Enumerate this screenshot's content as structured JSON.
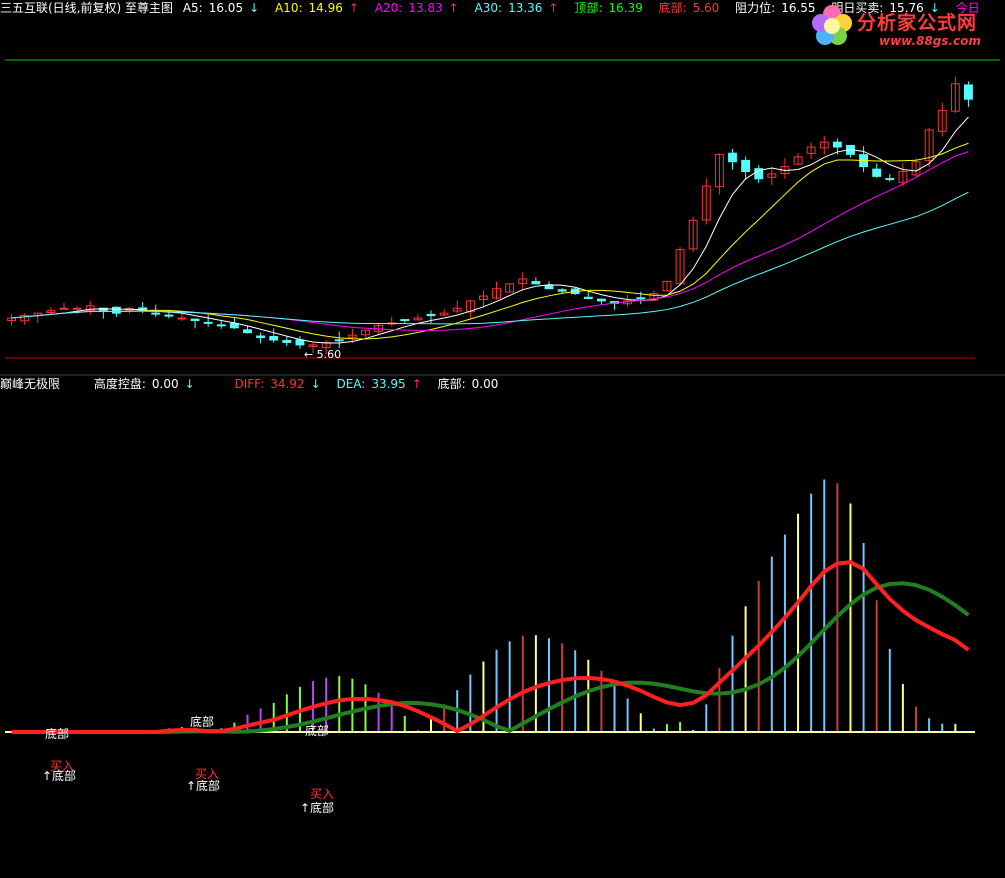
{
  "header": {
    "stock": "三五互联(日线,前复权) 至尊主图",
    "a5_label": "A5:",
    "a5_value": "16.05",
    "a5_arrow": "↓",
    "a10_label": "A10:",
    "a10_value": "14.96",
    "a10_arrow": "↑",
    "a20_label": "A20:",
    "a20_value": "13.83",
    "a20_arrow": "↑",
    "a30_label": "A30:",
    "a30_value": "13.36",
    "a30_arrow": "↑",
    "top_label": "顶部:",
    "top_value": "16.39",
    "bottom_label": "底部:",
    "bottom_value": "5.60",
    "resist_label": "阻力位:",
    "resist_value": "16.55",
    "tomorrow_label": "明日买卖:",
    "tomorrow_value": "15.76",
    "tomorrow_arrow": "↓",
    "today_label": "今日"
  },
  "subheader": {
    "indicator": "巅峰无极限",
    "height_label": "高度控盘:",
    "height_value": "0.00",
    "height_arrow": "↓",
    "diff_label": "DIFF:",
    "diff_value": "34.92",
    "diff_arrow": "↓",
    "dea_label": "DEA:",
    "dea_value": "33.95",
    "dea_arrow": "↑",
    "bottom_label": "底部:",
    "bottom_value": "0.00"
  },
  "logo": {
    "text": "分析家公式网",
    "url": "www.88gs.com"
  },
  "colors": {
    "up": "#ff3232",
    "down": "#54fcfc",
    "ma5": "#ffffff",
    "ma10": "#ffff00",
    "ma20": "#ff00ff",
    "ma30": "#54fcfc",
    "top_line": "#00c800",
    "bottom_line": "#c80000",
    "diff": "#ff2020",
    "dea": "#208020",
    "hist_pos_yellow": "#ffff80",
    "hist_neg_green": "#80ff40",
    "hist_neg_purple": "#c040ff"
  },
  "chart_data": [
    {
      "type": "candlestick",
      "title": "",
      "low_annotation": "5.60",
      "closes": [
        6.8,
        6.9,
        7.0,
        7.1,
        7.2,
        7.2,
        7.3,
        7.1,
        7.0,
        7.2,
        7.1,
        7.0,
        6.9,
        6.8,
        6.7,
        6.6,
        6.5,
        6.4,
        6.2,
        6.0,
        5.9,
        5.8,
        5.7,
        5.7,
        5.8,
        5.9,
        6.1,
        6.3,
        6.5,
        6.6,
        6.7,
        6.8,
        6.9,
        7.0,
        7.2,
        7.5,
        7.7,
        8.0,
        8.2,
        8.4,
        8.2,
        8.0,
        7.9,
        7.8,
        7.6,
        7.5,
        7.4,
        7.5,
        7.6,
        7.8,
        8.3,
        9.6,
        10.8,
        12.2,
        13.5,
        13.2,
        12.8,
        12.5,
        12.7,
        13.0,
        13.4,
        13.8,
        14.0,
        13.8,
        13.5,
        13.0,
        12.6,
        12.5,
        12.8,
        13.2,
        14.5,
        15.3,
        16.39,
        15.76
      ],
      "ma_series": [
        "A5",
        "A10",
        "A20",
        "A30"
      ]
    },
    {
      "type": "macd",
      "diff": 34.92,
      "dea": 33.95,
      "markers": [
        "底部",
        "底部",
        "底部",
        "↑底部",
        "↑底部",
        "↑底部",
        "买入",
        "买入",
        "买入"
      ]
    }
  ]
}
